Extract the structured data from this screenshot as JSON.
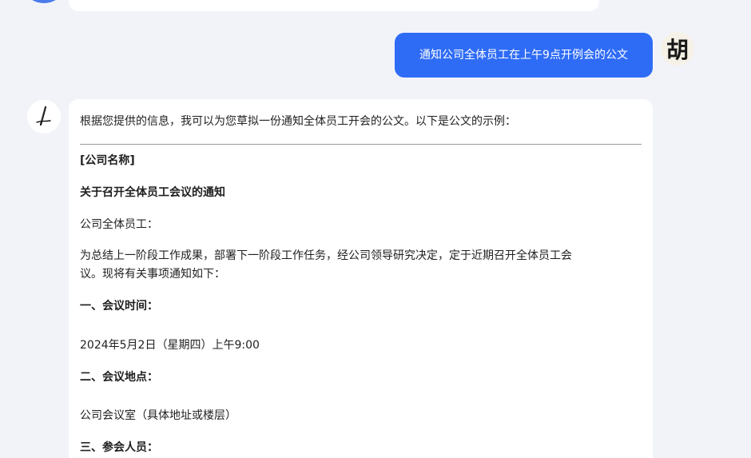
{
  "user_message": {
    "text": "通知公司全体员工在上午9点开例会的公文",
    "avatar_char": "胡"
  },
  "assistant_message": {
    "intro": "根据您提供的信息，我可以为您草拟一份通知全体员工开会的公文。以下是公文的示例：",
    "company_name": "[公司名称]",
    "title": "关于召开全体员工会议的通知",
    "salutation": "公司全体员工：",
    "body_line1": "为总结上一阶段工作成果，部署下一阶段工作任务，经公司领导研究决定，定于近期召开全体员工会",
    "body_line2": "议。现将有关事项通知如下：",
    "section1_heading": "一、会议时间：",
    "section1_value": "2024年5月2日（星期四）上午9:00",
    "section2_heading": "二、会议地点：",
    "section2_value": "公司会议室（具体地址或楼层）",
    "section3_heading": "三、参会人员："
  }
}
